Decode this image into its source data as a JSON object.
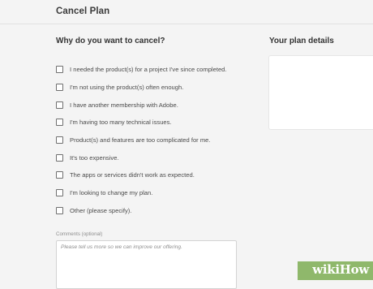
{
  "header": {
    "title": "Cancel Plan"
  },
  "reasons": {
    "heading": "Why do you want to cancel?",
    "options": [
      "I needed the product(s) for a project I've since completed.",
      "I'm not using the product(s) often enough.",
      "I have another membership with Adobe.",
      "I'm having too many technical issues.",
      "Product(s) and features are too complicated for me.",
      "It's too expensive.",
      "The apps or services didn't work as expected.",
      "I'm looking to change my plan.",
      "Other (please specify)."
    ]
  },
  "comments": {
    "label": "Comments (optional)",
    "placeholder": "Please tell us more so we can improve our offering."
  },
  "plan": {
    "heading": "Your plan details"
  },
  "watermark": {
    "text": "wikiHow"
  }
}
